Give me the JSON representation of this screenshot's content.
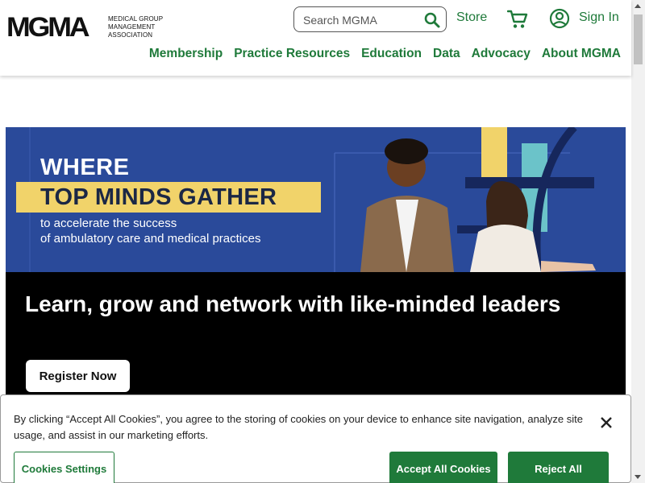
{
  "header": {
    "logo_mark": "MGMA",
    "logo_text": "Medical Group Management Association",
    "search_placeholder": "Search MGMA",
    "store_label": "Store",
    "signin_label": "Sign In",
    "nav": [
      "Membership",
      "Practice Resources",
      "Education",
      "Data",
      "Advocacy",
      "About MGMA"
    ]
  },
  "hero": {
    "where": "WHERE",
    "highlight": "TOP MINDS GATHER",
    "sub_line1": "to accelerate the success",
    "sub_line2": "of ambulatory care and medical practices"
  },
  "promo": {
    "title": "Learn, grow and network with like-minded leaders",
    "button": "Register Now"
  },
  "cookie_banner": {
    "text": "By clicking “Accept All Cookies”, you agree to the storing of cookies on your device to enhance site navigation, analyze site usage, and assist in our marketing efforts.",
    "settings_label": "Cookies Settings",
    "accept_label": "Accept All Cookies",
    "reject_label": "Reject All"
  },
  "colors": {
    "brand_green": "#1f7a3a",
    "hero_blue": "#2a4a9a",
    "hero_yellow": "#f1d36a"
  },
  "icons": [
    "search-icon",
    "cart-icon",
    "user-icon",
    "close-icon"
  ]
}
